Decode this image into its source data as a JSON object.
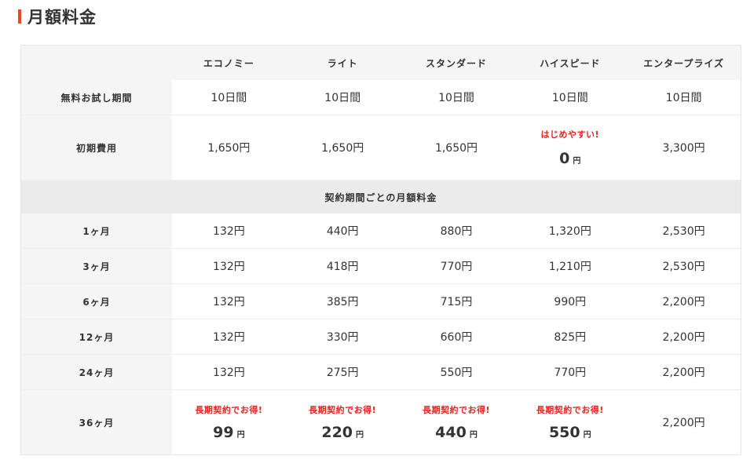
{
  "title": "月額料金",
  "plans": [
    "エコノミー",
    "ライト",
    "スタンダード",
    "ハイスピード",
    "エンタープライズ"
  ],
  "trial": {
    "label": "無料お試し期間",
    "values": [
      "10日間",
      "10日間",
      "10日間",
      "10日間",
      "10日間"
    ]
  },
  "initial": {
    "label": "初期費用",
    "values": [
      "1,650円",
      "1,650円",
      "1,650円",
      "",
      "3,300円"
    ],
    "promo": "はじめやすい!",
    "zero_value": "0",
    "zero_unit": "円"
  },
  "section_label": "契約期間ごとの月額料金",
  "months": [
    {
      "label": "1ヶ月",
      "values": [
        "132円",
        "440円",
        "880円",
        "1,320円",
        "2,530円"
      ]
    },
    {
      "label": "3ヶ月",
      "values": [
        "132円",
        "418円",
        "770円",
        "1,210円",
        "2,530円"
      ]
    },
    {
      "label": "6ヶ月",
      "values": [
        "132円",
        "385円",
        "715円",
        "990円",
        "2,200円"
      ]
    },
    {
      "label": "12ヶ月",
      "values": [
        "132円",
        "330円",
        "660円",
        "825円",
        "2,200円"
      ]
    },
    {
      "label": "24ヶ月",
      "values": [
        "132円",
        "275円",
        "550円",
        "770円",
        "2,200円"
      ]
    }
  ],
  "m36": {
    "label": "36ヶ月",
    "promo": "長期契約でお得!",
    "values": [
      "99",
      "220",
      "440",
      "550"
    ],
    "unit": "円",
    "enterprise": "2,200円"
  },
  "colors": {
    "accent": "#e8491d",
    "promo": "#e8231d",
    "header_bg": "#f5f5f5",
    "section_bg": "#ebebeb"
  }
}
